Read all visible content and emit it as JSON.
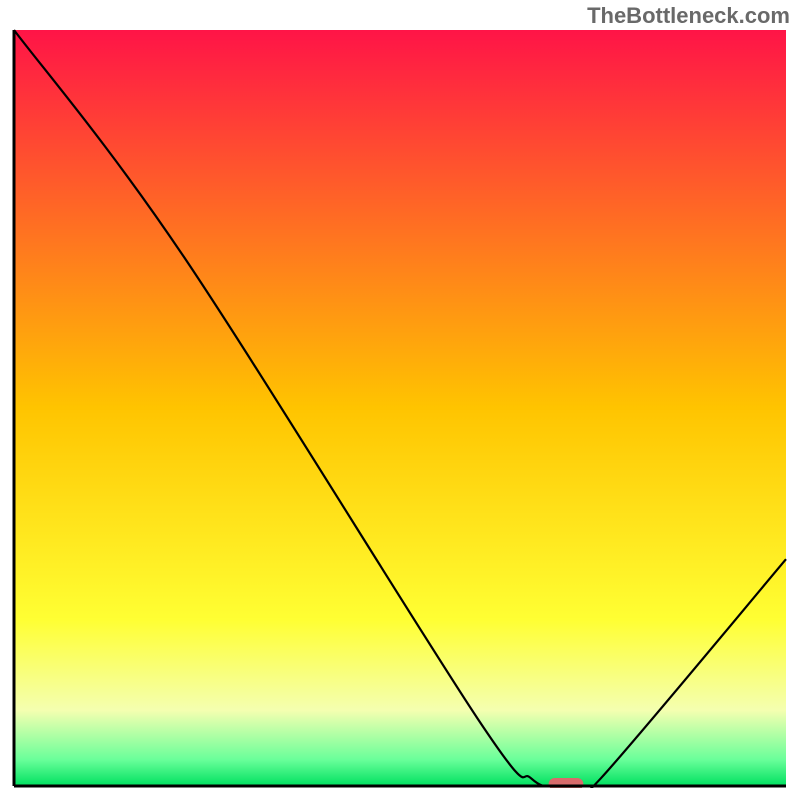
{
  "watermark": "TheBottleneck.com",
  "chart_data": {
    "type": "line",
    "title": "",
    "xlabel": "",
    "ylabel": "",
    "xlim": [
      0,
      100
    ],
    "ylim": [
      0,
      100
    ],
    "x": [
      0,
      22,
      60,
      67,
      70,
      73,
      76,
      100
    ],
    "values": [
      100,
      70,
      9,
      1,
      0,
      0,
      1,
      30
    ],
    "gradient_stops": [
      {
        "offset": 0.0,
        "color": "#ff1447"
      },
      {
        "offset": 0.5,
        "color": "#ffc400"
      },
      {
        "offset": 0.78,
        "color": "#ffff33"
      },
      {
        "offset": 0.9,
        "color": "#f4ffb0"
      },
      {
        "offset": 0.965,
        "color": "#6aff9a"
      },
      {
        "offset": 1.0,
        "color": "#00e060"
      }
    ],
    "marker": {
      "x": 71.5,
      "y": 0,
      "color": "#d86b6b",
      "width": 4.5,
      "height": 1.6
    },
    "axis_color": "#000000"
  }
}
